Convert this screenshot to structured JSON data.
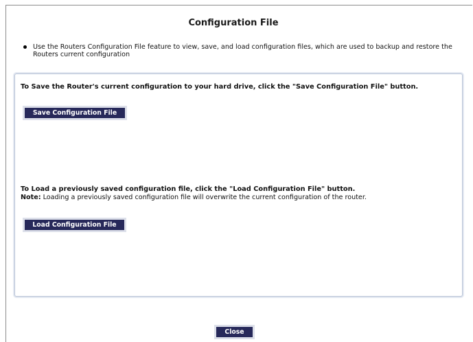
{
  "title": "Configuration File",
  "intro": {
    "text": "Use the Routers Configuration File feature to view, save, and load configuration files, which are used to backup and restore the Routers current configuration"
  },
  "save_section": {
    "instruction": "To Save the Router's current configuration to your hard drive, click the \"Save Configuration File\" button.",
    "button_label": "Save Configuration File"
  },
  "load_section": {
    "instruction": "To Load a previously saved configuration file, click the \"Load Configuration File\" button.",
    "note_label": "Note:",
    "note_text": " Loading a previously saved configuration file will overwrite the current configuration of the router.",
    "button_label": "Load Configuration File"
  },
  "footer": {
    "close_label": "Close"
  },
  "colors": {
    "button_bg": "#27295a",
    "button_text": "#ffffff",
    "panel_border": "#b7c2d6"
  }
}
